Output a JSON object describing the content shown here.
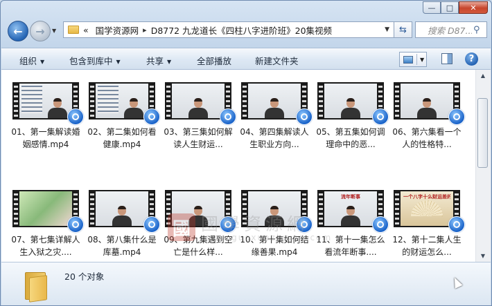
{
  "window": {
    "caption_buttons": {
      "minimize": "—",
      "maximize": "□",
      "close": "✕"
    }
  },
  "nav": {
    "back_icon": "back-arrow-icon",
    "forward_icon": "forward-arrow-icon",
    "address": {
      "prefix": "«",
      "crumbs": [
        "国学资源网",
        "D8772 九龙道长《四柱八字进阶班》20集视频"
      ],
      "separator": "▸"
    },
    "search_placeholder": "搜索 D87...",
    "refresh_icon": "⇆",
    "search_icon": "⚲"
  },
  "toolbar": {
    "organize": "组织",
    "include_library": "包含到库中",
    "share": "共享",
    "play_all": "全部播放",
    "new_folder": "新建文件夹",
    "help": "?"
  },
  "files": [
    {
      "caption": "01、第一集解读婚姻感情.mp4",
      "style": "slides"
    },
    {
      "caption": "02、第二集如何看健康.mp4",
      "style": "slides"
    },
    {
      "caption": "03、第三集如何解读人生财运...",
      "style": "white"
    },
    {
      "caption": "04、第四集解读人生职业方向...",
      "style": "white"
    },
    {
      "caption": "05、第五集如何调理命中的恶...",
      "style": "white"
    },
    {
      "caption": "06、第六集看一个人的性格特...",
      "style": "white"
    },
    {
      "caption": "07、第七集详解人生入狱之灾....",
      "style": "map"
    },
    {
      "caption": "08、第八集什么是库墓.mp4",
      "style": "white"
    },
    {
      "caption": "09、第九集遇到空亡是什么样...",
      "style": "white"
    },
    {
      "caption": "10、第十集如何结缘善果.mp4",
      "style": "white"
    },
    {
      "caption": "11、第十一集怎么看流年断事....",
      "style": "white"
    },
    {
      "caption": "12、第十二集人生的财运怎么...",
      "style": "fan"
    }
  ],
  "thumb_labels": {
    "file11": "流年断事",
    "file12": "一个八字十么财运差的"
  },
  "watermark": {
    "seal": "國",
    "title": "國學資源網",
    "url": "www.guoxueziyuan.com"
  },
  "details": {
    "count": "20 个对象"
  }
}
